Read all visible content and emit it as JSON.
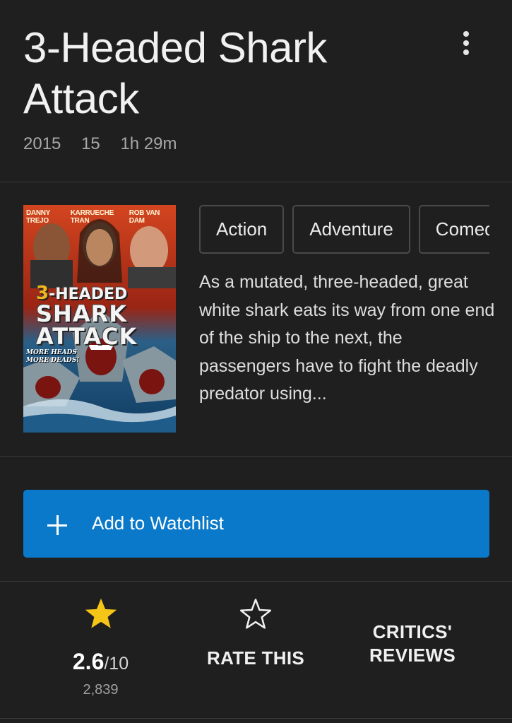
{
  "title": "3-Headed Shark Attack",
  "meta": {
    "year": "2015",
    "certificate": "15",
    "runtime": "1h 29m"
  },
  "menu": {
    "icon": "more-vert-icon"
  },
  "poster": {
    "cast": [
      "DANNY TREJO",
      "KARRUECHE TRAN",
      "ROB VAN DAM"
    ],
    "title_line1_number": "3",
    "title_line1_rest": "-HEADED",
    "title_line2": "SHARK",
    "title_line3": "ATTACK",
    "tagline_line1": "MORE HEADS",
    "tagline_line2": "MORE DEADS!"
  },
  "genres": [
    "Action",
    "Adventure",
    "Comedy"
  ],
  "plot": "As a mutated, three-headed, great white shark eats its way from one end of the ship to the next, the passengers have to fight the deadly predator using...",
  "watchlist": {
    "label": "Add to Watchlist",
    "icon": "plus-icon",
    "color": "#0b79c9"
  },
  "ratings": {
    "imdb": {
      "score": "2.6",
      "out_of": "/10",
      "votes": "2,839",
      "icon": "star-filled-icon",
      "star_color": "#f5c518"
    },
    "rate_this": {
      "label": "RATE THIS",
      "icon": "star-outline-icon"
    },
    "critics": {
      "line1": "CRITICS'",
      "line2": "REVIEWS"
    }
  }
}
